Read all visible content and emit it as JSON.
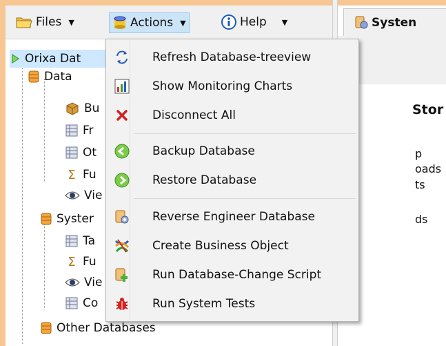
{
  "toolbar": {
    "files_label": "Files",
    "actions_label": "Actions",
    "help_label": "Help"
  },
  "tree": {
    "root": "Orixa Dat",
    "data": "Data",
    "data_children": [
      "Bu",
      "Fr",
      "Ot",
      "Fu",
      "Vie"
    ],
    "system": "Syster",
    "system_children": [
      "Ta",
      "Fu",
      "Vie",
      "Co"
    ],
    "other": "Other Databases"
  },
  "right": {
    "tab_label": "Systen",
    "section_title": "Stor",
    "fragments": [
      "p",
      "oads",
      "ts",
      "ds"
    ]
  },
  "menu": {
    "items": [
      {
        "label": "Refresh Database-treeview",
        "icon": "refresh-icon"
      },
      {
        "label": "Show Monitoring Charts",
        "icon": "chart-icon"
      },
      {
        "label": "Disconnect All",
        "icon": "close-icon"
      },
      {
        "label": "Backup Database",
        "icon": "backup-icon"
      },
      {
        "label": "Restore Database",
        "icon": "restore-icon"
      },
      {
        "label": "Reverse Engineer Database",
        "icon": "reverse-engineer-icon"
      },
      {
        "label": "Create Business Object",
        "icon": "business-object-icon"
      },
      {
        "label": "Run Database-Change Script",
        "icon": "script-icon"
      },
      {
        "label": "Run System Tests",
        "icon": "bug-icon"
      }
    ]
  }
}
